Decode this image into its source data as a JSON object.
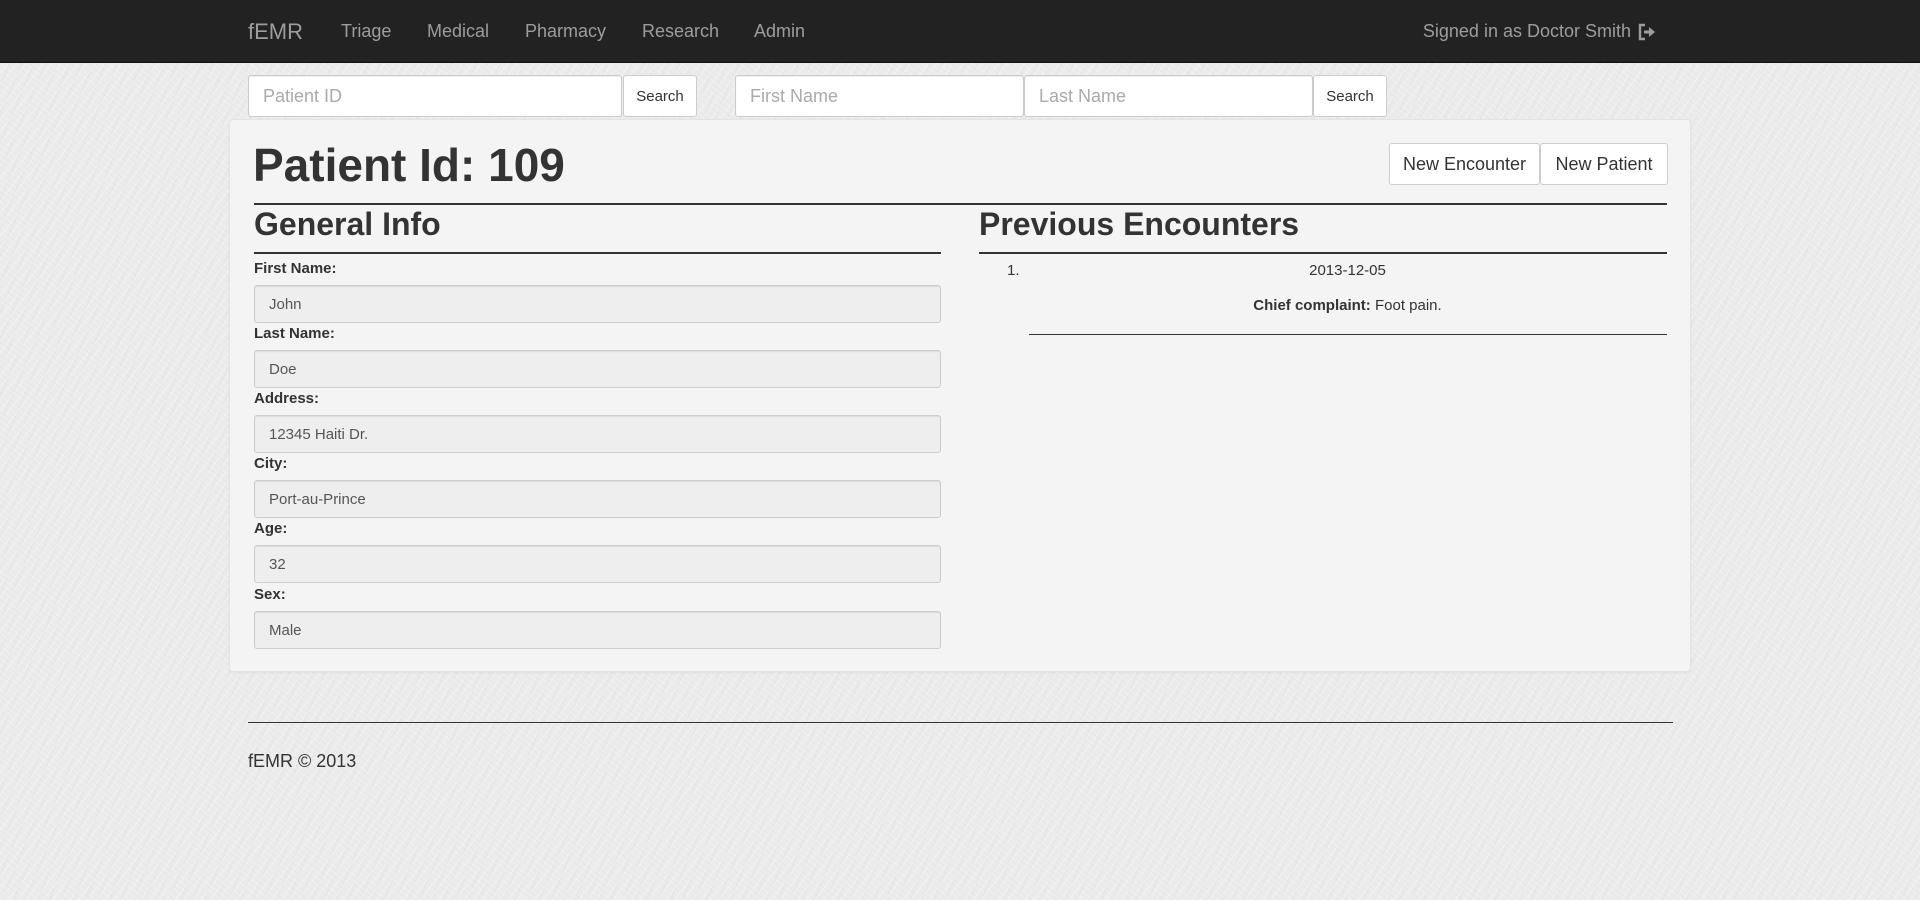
{
  "navbar": {
    "brand": "fEMR",
    "links": [
      "Triage",
      "Medical",
      "Pharmacy",
      "Research",
      "Admin"
    ],
    "signed_in": "Signed in as Doctor Smith",
    "logout_icon": "logout-icon"
  },
  "search": {
    "patient_id_placeholder": "Patient ID",
    "search_label": "Search",
    "first_name_placeholder": "First Name",
    "last_name_placeholder": "Last Name",
    "search_label_2": "Search"
  },
  "page": {
    "title": "Patient Id: 109",
    "new_encounter": "New Encounter",
    "new_patient": "New Patient"
  },
  "general_info": {
    "title": "General Info",
    "fields": [
      {
        "label": "First Name:",
        "value": "John"
      },
      {
        "label": "Last Name:",
        "value": "Doe"
      },
      {
        "label": "Address:",
        "value": "12345 Haiti Dr."
      },
      {
        "label": "City:",
        "value": "Port-au-Prince"
      },
      {
        "label": "Age:",
        "value": "32"
      },
      {
        "label": "Sex:",
        "value": "Male"
      }
    ]
  },
  "encounters": {
    "title": "Previous Encounters",
    "items": [
      {
        "number": "1.",
        "date": "2013-12-05",
        "complaint_label": "Chief complaint:",
        "complaint": "Foot pain."
      }
    ]
  },
  "footer": {
    "text": "fEMR © 2013"
  },
  "colors": {
    "navbar": "#222222",
    "nav_text": "#9d9d9d",
    "panel": "#f4f4f4"
  }
}
